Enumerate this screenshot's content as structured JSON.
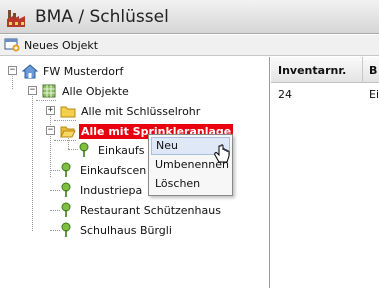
{
  "window": {
    "title": "BMA / Schlüssel"
  },
  "toolbar": {
    "new_object_label": "Neues Objekt"
  },
  "tree": {
    "root": "FW Musterdorf",
    "all_objects": "Alle Objekte",
    "group_key": "Alle mit Schlüsselrohr",
    "group_sprinkler": "Alle mit Sprinkleranlage",
    "child_truncated": "Einkaufs",
    "items": [
      "Einkaufscen",
      "Industriepa",
      "Restaurant Schützenhaus",
      "Schulhaus Bürgli"
    ]
  },
  "grid": {
    "columns": [
      "Inventarnr.",
      "B"
    ],
    "rows": [
      {
        "inventarnr": "24",
        "b": "Ei"
      }
    ]
  },
  "context_menu": {
    "items": [
      "Neu",
      "Umbenennen",
      "Löschen"
    ],
    "hovered": "Neu"
  },
  "colors": {
    "selection": "#e8000e",
    "menu_hover": "#dfe8f6"
  }
}
